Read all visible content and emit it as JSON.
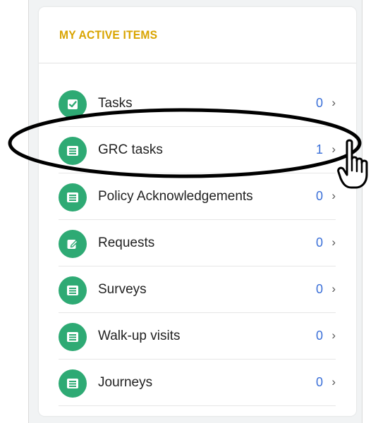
{
  "panel": {
    "title": "MY ACTIVE ITEMS"
  },
  "items": [
    {
      "label": "Tasks",
      "count": "0",
      "icon": "checkbox-icon",
      "chevron": "›"
    },
    {
      "label": "GRC tasks",
      "count": "1",
      "icon": "list-icon",
      "chevron": "›"
    },
    {
      "label": "Policy Acknowledgements",
      "count": "0",
      "icon": "list-icon",
      "chevron": "›"
    },
    {
      "label": "Requests",
      "count": "0",
      "icon": "edit-icon",
      "chevron": "›"
    },
    {
      "label": "Surveys",
      "count": "0",
      "icon": "list-icon",
      "chevron": "›"
    },
    {
      "label": "Walk-up visits",
      "count": "0",
      "icon": "list-icon",
      "chevron": "›"
    },
    {
      "label": "Journeys",
      "count": "0",
      "icon": "list-icon",
      "chevron": "›"
    }
  ],
  "colors": {
    "title": "#d9a400",
    "icon_bg": "#2eaa74",
    "count": "#3a6fd8",
    "highlight": "#000000"
  }
}
